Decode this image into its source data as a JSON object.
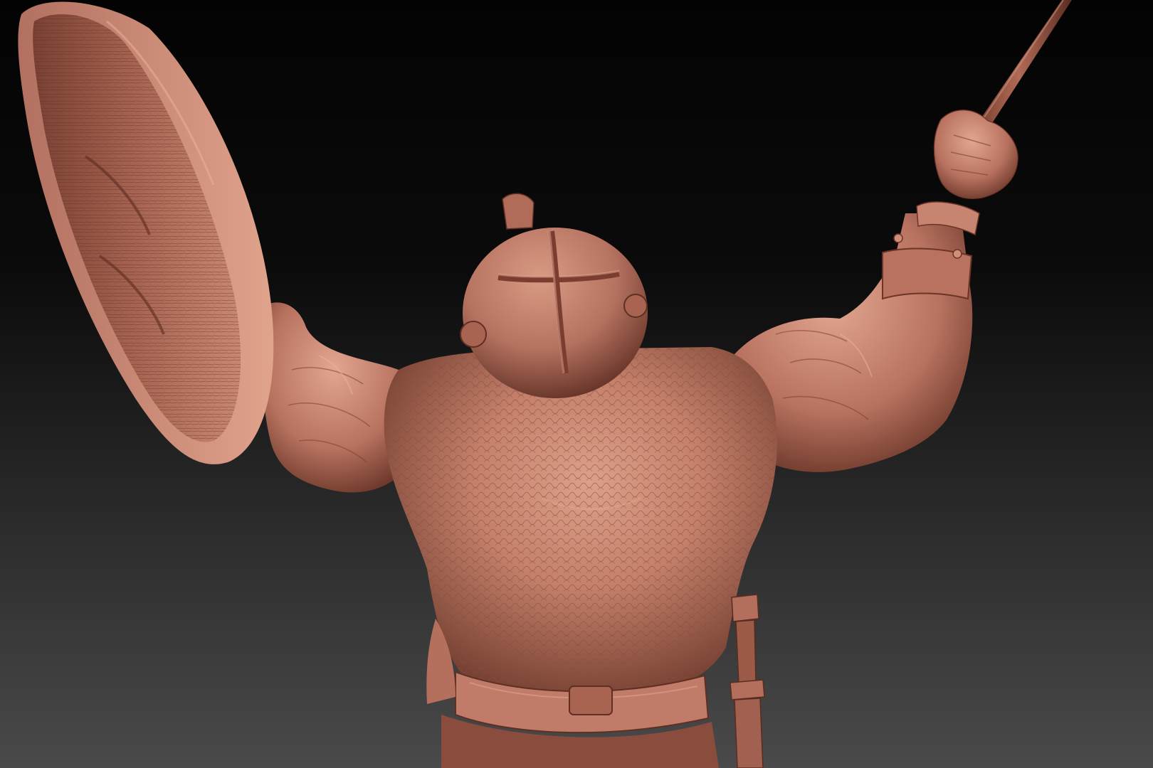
{
  "viewport": {
    "background_top": "#030303",
    "background_bottom": "#4a4a4a",
    "material_base": "#b97561",
    "material_light": "#e0a48e",
    "material_shadow": "#6e3a2c",
    "material_dark": "#4a2218"
  },
  "model": {
    "icons": {
      "shield": "shield-icon",
      "helmet": "helmet-icon",
      "spear": "spear-icon",
      "sword": "sword-icon"
    }
  }
}
